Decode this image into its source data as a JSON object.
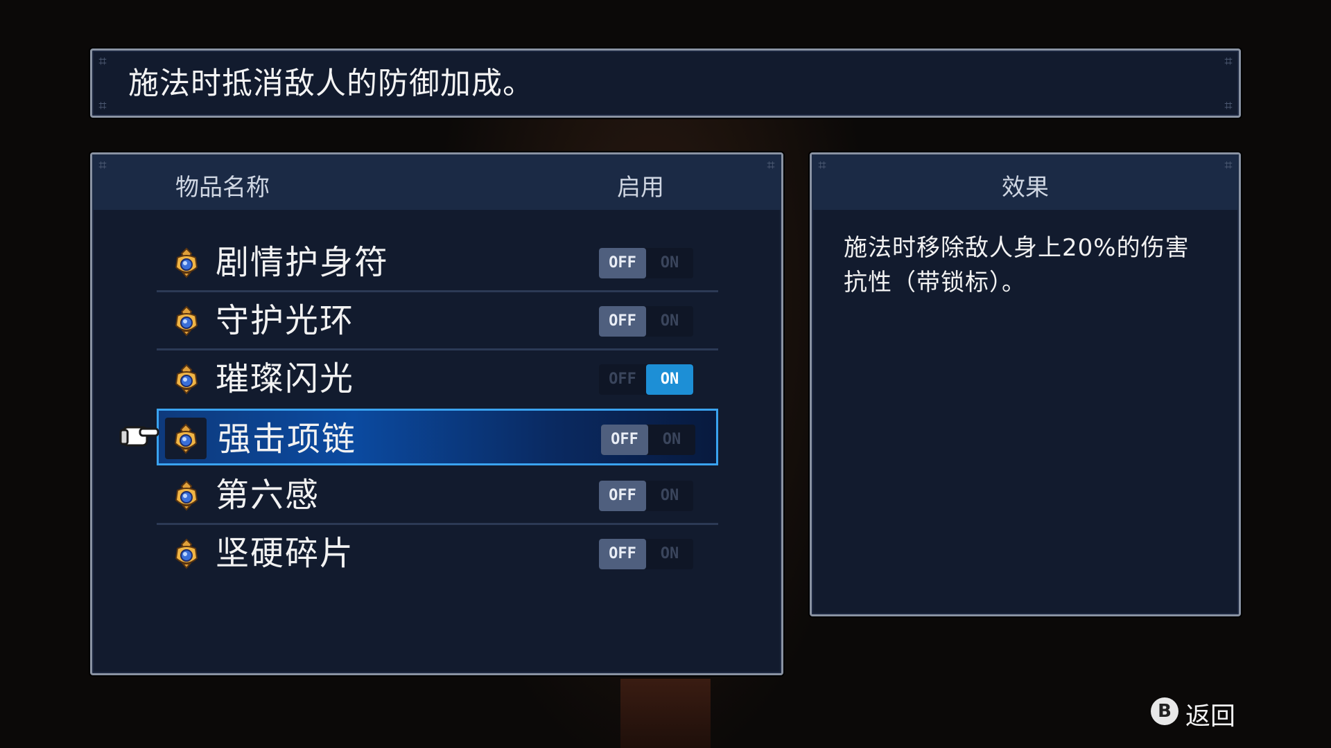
{
  "description": "施法时抵消敌人的防御加成。",
  "list": {
    "header_name": "物品名称",
    "header_enable": "启用",
    "items": [
      {
        "name": "剧情护身符",
        "state": "off",
        "selected": false
      },
      {
        "name": "守护光环",
        "state": "off",
        "selected": false
      },
      {
        "name": "璀璨闪光",
        "state": "on",
        "selected": false
      },
      {
        "name": "强击项链",
        "state": "off",
        "selected": true
      },
      {
        "name": "第六感",
        "state": "off",
        "selected": false
      },
      {
        "name": "坚硬碎片",
        "state": "off",
        "selected": false
      }
    ],
    "toggle_off_label": "OFF",
    "toggle_on_label": "ON"
  },
  "effect": {
    "title": "效果",
    "text": "施法时移除敌人身上20%的伤害抗性（带锁标）。"
  },
  "back_hint": {
    "button": "B",
    "label": "返回"
  },
  "colors": {
    "panel_bg": "#121b2e",
    "header_bg": "#1b2a45",
    "selection_border": "#3aa3f0",
    "toggle_on": "#1d8fd6",
    "toggle_off": "#4f5f7e"
  },
  "icons": {
    "item": "amulet-icon",
    "cursor": "pointing-hand-icon"
  }
}
